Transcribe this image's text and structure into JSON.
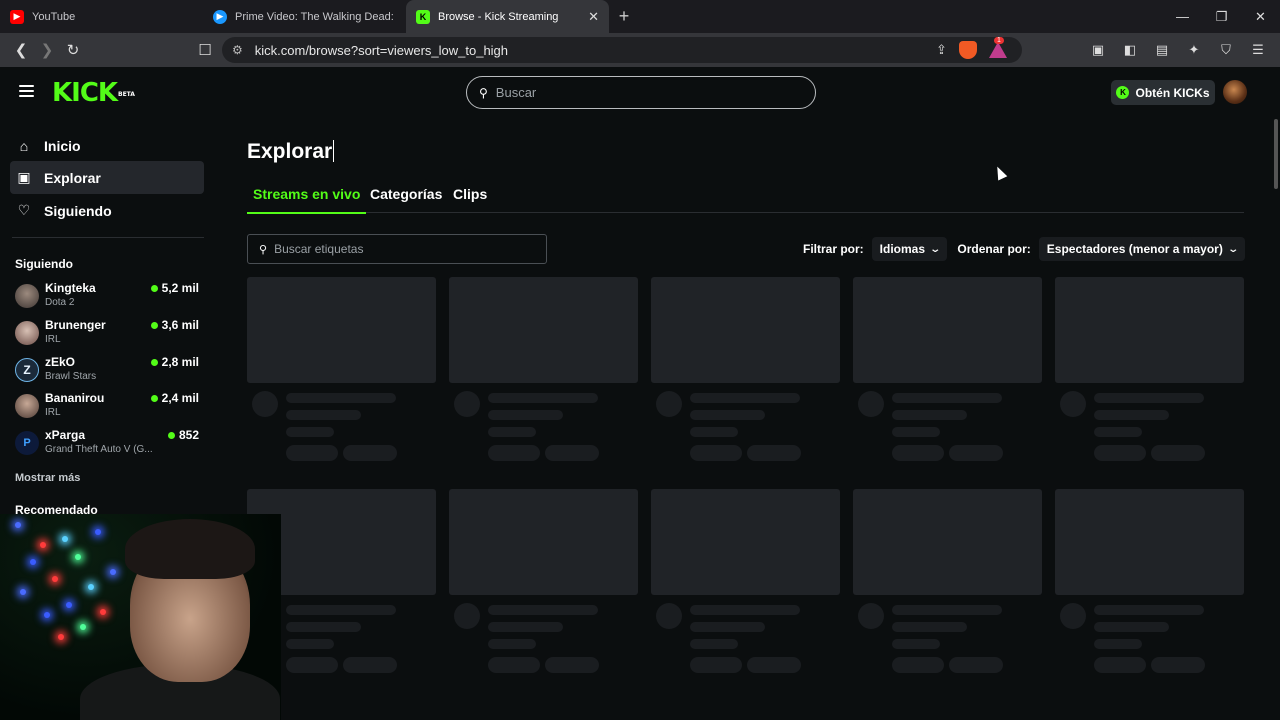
{
  "browser": {
    "tabs": [
      {
        "title": "YouTube",
        "favicon": "youtube-icon",
        "color": "#ff0000",
        "active": false
      },
      {
        "title": "Prime Video: The Walking Dead: Dea",
        "favicon": "prime-video-icon",
        "color": "#1a98ff",
        "active": false
      },
      {
        "title": "Browse - Kick Streaming",
        "favicon": "kick-icon",
        "color": "#53fc18",
        "active": true
      }
    ],
    "url": "kick.com/browse?sort=viewers_low_to_high"
  },
  "header": {
    "logo_text": "KICK",
    "logo_badge": "BETA",
    "search_placeholder": "Buscar",
    "kicks_button": "Obtén KICKs"
  },
  "sidebar": {
    "nav": [
      {
        "label": "Inicio",
        "icon": "home-icon"
      },
      {
        "label": "Explorar",
        "icon": "browse-icon",
        "active": true
      },
      {
        "label": "Siguiendo",
        "icon": "heart-icon"
      }
    ],
    "following_title": "Siguiendo",
    "following": [
      {
        "name": "Kingteka",
        "category": "Dota 2",
        "viewers": "5,2 mil"
      },
      {
        "name": "Brunenger",
        "category": "IRL",
        "viewers": "3,6 mil"
      },
      {
        "name": "zEkO",
        "category": "Brawl Stars",
        "viewers": "2,8 mil"
      },
      {
        "name": "Bananirou",
        "category": "IRL",
        "viewers": "2,4 mil"
      },
      {
        "name": "xParga",
        "category": "Grand Theft Auto V (G...",
        "viewers": "852"
      }
    ],
    "show_more": "Mostrar más",
    "recommended_title": "Recomendado"
  },
  "main": {
    "title": "Explorar",
    "tabs": [
      "Streams en vivo",
      "Categorías",
      "Clips"
    ],
    "tag_search_placeholder": "Buscar etiquetas",
    "filter_label": "Filtrar por:",
    "filter_value": "Idiomas",
    "sort_label": "Ordenar por:",
    "sort_value": "Espectadores (menor a mayor)"
  },
  "colors": {
    "accent": "#53fc18",
    "background": "#0b0e0f"
  }
}
